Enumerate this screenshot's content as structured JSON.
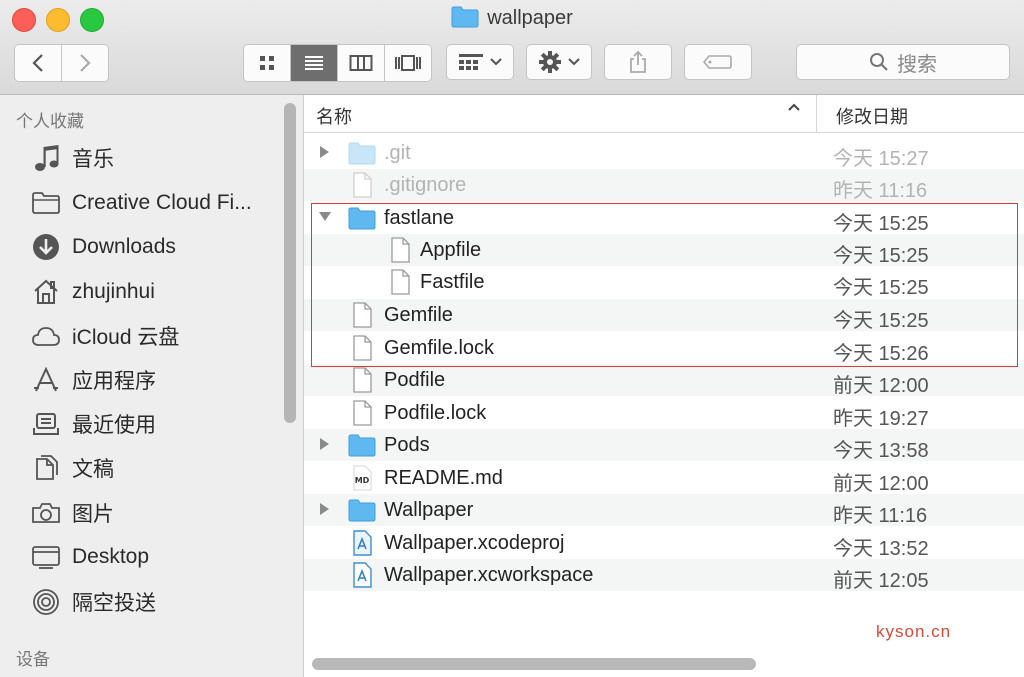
{
  "window": {
    "title": "wallpaper"
  },
  "toolbar": {
    "back_icon": "chevron-left-icon",
    "forward_icon": "chevron-right-icon",
    "view_modes": [
      "icon-view",
      "list-view",
      "column-view",
      "cover-flow-view"
    ],
    "active_view": "list-view",
    "search_placeholder": "搜索"
  },
  "sidebar": {
    "favorites_heading": "个人收藏",
    "items": [
      {
        "label": "音乐",
        "icon": "music-note-icon"
      },
      {
        "label": "Creative Cloud Fi...",
        "icon": "folder-icon"
      },
      {
        "label": "Downloads",
        "icon": "download-icon"
      },
      {
        "label": "zhujinhui",
        "icon": "home-icon"
      },
      {
        "label": "iCloud 云盘",
        "icon": "cloud-icon"
      },
      {
        "label": "应用程序",
        "icon": "applications-icon"
      },
      {
        "label": "最近使用",
        "icon": "recents-icon"
      },
      {
        "label": "文稿",
        "icon": "documents-icon"
      },
      {
        "label": "图片",
        "icon": "camera-icon"
      },
      {
        "label": "Desktop",
        "icon": "desktop-icon"
      },
      {
        "label": "隔空投送",
        "icon": "airdrop-icon"
      }
    ],
    "devices_heading": "设备"
  },
  "file_list": {
    "columns": {
      "name": "名称",
      "date": "修改日期"
    },
    "rows": [
      {
        "name": ".git",
        "date": "今天 15:27"
      },
      {
        "name": ".gitignore",
        "date": "昨天 11:16"
      },
      {
        "name": "fastlane",
        "date": "今天 15:25"
      },
      {
        "name": "Appfile",
        "date": "今天 15:25"
      },
      {
        "name": "Fastfile",
        "date": "今天 15:25"
      },
      {
        "name": "Gemfile",
        "date": "今天 15:25"
      },
      {
        "name": "Gemfile.lock",
        "date": "今天 15:26"
      },
      {
        "name": "Podfile",
        "date": "前天 12:00"
      },
      {
        "name": "Podfile.lock",
        "date": "昨天 19:27"
      },
      {
        "name": "Pods",
        "date": "今天 13:58"
      },
      {
        "name": "README.md",
        "date": "前天 12:00"
      },
      {
        "name": "Wallpaper",
        "date": "昨天 11:16"
      },
      {
        "name": "Wallpaper.xcodeproj",
        "date": "今天 13:52"
      },
      {
        "name": "Wallpaper.xcworkspace",
        "date": "前天 12:05"
      }
    ]
  },
  "watermark": "kyson.cn",
  "colors": {
    "highlight_border": "#d63a3a",
    "folder_blue": "#5fb8ef",
    "watermark": "#d84a3a"
  }
}
